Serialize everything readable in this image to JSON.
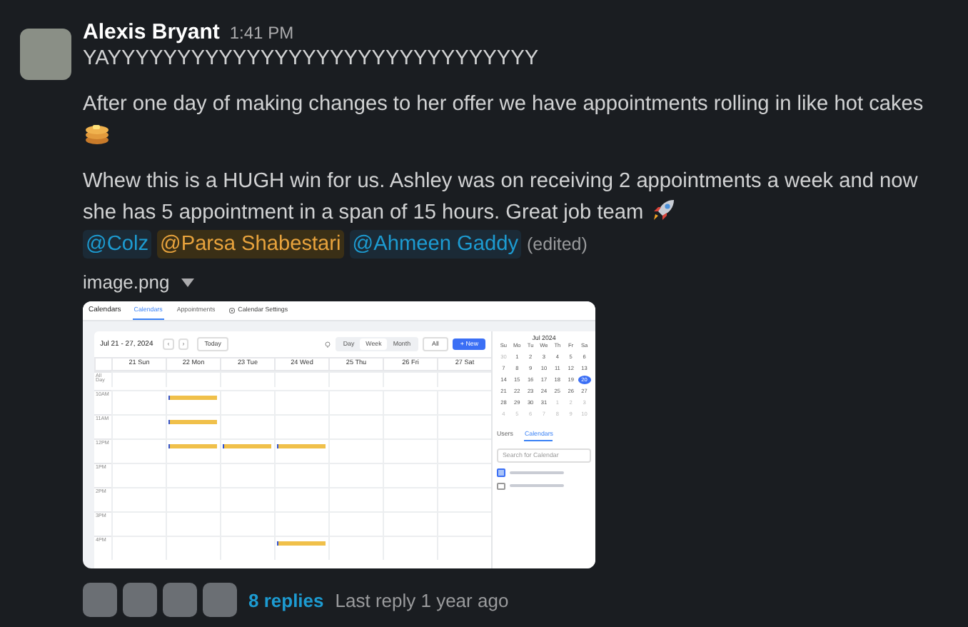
{
  "message": {
    "author": "Alexis Bryant",
    "time": "1:41 PM",
    "paragraphs": [
      {
        "text": "YAYYYYYYYYYYYYYYYYYYYYYYYYYYYYYYY",
        "kind": "plain"
      },
      {
        "text": "After one day of making changes to her offer we have appointments rolling in like hot cakes",
        "kind": "pancakes"
      },
      {
        "text": "Whew this is a HUGH win for us. Ashley was on receiving 2 appointments a week and now she has 5 appointment in a span of 15 hours. Great job team",
        "kind": "rocket"
      }
    ],
    "mentions": [
      {
        "text": "@Colz",
        "kind": "user"
      },
      {
        "text": "@Parsa Shabestari",
        "kind": "highlight"
      },
      {
        "text": "@Ahmeen Gaddy",
        "kind": "user"
      }
    ],
    "edited": "(edited)"
  },
  "attachment": {
    "filename": "image.png",
    "screenshot": {
      "app_title": "Calendars",
      "tabs": [
        {
          "label": "Calendars",
          "selected": true
        },
        {
          "label": "Appointments",
          "selected": false
        }
      ],
      "settings": "Calendar Settings",
      "range": "Jul 21 - 27, 2024",
      "prev": "‹",
      "next": "›",
      "today": "Today",
      "views": [
        {
          "label": "Day",
          "selected": false
        },
        {
          "label": "Week",
          "selected": true
        },
        {
          "label": "Month",
          "selected": false
        }
      ],
      "filter": "All",
      "new_button": "+ New",
      "all_day": "All Day",
      "days": [
        "21 Sun",
        "22 Mon",
        "23 Tue",
        "24 Wed",
        "25 Thu",
        "26 Fri",
        "27 Sat"
      ],
      "rows": [
        {
          "time": "10AM",
          "events": [
            false,
            true,
            false,
            false,
            false,
            false,
            false
          ]
        },
        {
          "time": "11AM",
          "events": [
            false,
            true,
            false,
            false,
            false,
            false,
            false
          ]
        },
        {
          "time": "12PM",
          "events": [
            false,
            true,
            true,
            true,
            false,
            false,
            false
          ]
        },
        {
          "time": "1PM",
          "events": [
            false,
            false,
            false,
            false,
            false,
            false,
            false
          ]
        },
        {
          "time": "2PM",
          "events": [
            false,
            false,
            false,
            false,
            false,
            false,
            false
          ]
        },
        {
          "time": "3PM",
          "events": [
            false,
            false,
            false,
            false,
            false,
            false,
            false
          ]
        },
        {
          "time": "4PM",
          "events": [
            false,
            false,
            false,
            true,
            false,
            false,
            false
          ]
        }
      ],
      "mini_calendar": {
        "month": "Jul 2024",
        "weekdays": [
          "Su",
          "Mo",
          "Tu",
          "We",
          "Th",
          "Fr",
          "Sa"
        ],
        "weeks": [
          [
            {
              "d": "30",
              "muted": true,
              "selected": false
            },
            {
              "d": "1",
              "muted": false,
              "selected": false
            },
            {
              "d": "2",
              "muted": false,
              "selected": false
            },
            {
              "d": "3",
              "muted": false,
              "selected": false
            },
            {
              "d": "4",
              "muted": false,
              "selected": false
            },
            {
              "d": "5",
              "muted": false,
              "selected": false
            },
            {
              "d": "6",
              "muted": false,
              "selected": false
            }
          ],
          [
            {
              "d": "7",
              "muted": false,
              "selected": false
            },
            {
              "d": "8",
              "muted": false,
              "selected": false
            },
            {
              "d": "9",
              "muted": false,
              "selected": false
            },
            {
              "d": "10",
              "muted": false,
              "selected": false
            },
            {
              "d": "11",
              "muted": false,
              "selected": false
            },
            {
              "d": "12",
              "muted": false,
              "selected": false
            },
            {
              "d": "13",
              "muted": false,
              "selected": false
            }
          ],
          [
            {
              "d": "14",
              "muted": false,
              "selected": false
            },
            {
              "d": "15",
              "muted": false,
              "selected": false
            },
            {
              "d": "16",
              "muted": false,
              "selected": false
            },
            {
              "d": "17",
              "muted": false,
              "selected": false
            },
            {
              "d": "18",
              "muted": false,
              "selected": false
            },
            {
              "d": "19",
              "muted": false,
              "selected": false
            },
            {
              "d": "20",
              "muted": false,
              "selected": true
            }
          ],
          [
            {
              "d": "21",
              "muted": false,
              "selected": false
            },
            {
              "d": "22",
              "muted": false,
              "selected": false
            },
            {
              "d": "23",
              "muted": false,
              "selected": false
            },
            {
              "d": "24",
              "muted": false,
              "selected": false
            },
            {
              "d": "25",
              "muted": false,
              "selected": false
            },
            {
              "d": "26",
              "muted": false,
              "selected": false
            },
            {
              "d": "27",
              "muted": false,
              "selected": false
            }
          ],
          [
            {
              "d": "28",
              "muted": false,
              "selected": false
            },
            {
              "d": "29",
              "muted": false,
              "selected": false
            },
            {
              "d": "30",
              "muted": false,
              "selected": false
            },
            {
              "d": "31",
              "muted": false,
              "selected": false
            },
            {
              "d": "1",
              "muted": true,
              "selected": false
            },
            {
              "d": "2",
              "muted": true,
              "selected": false
            },
            {
              "d": "3",
              "muted": true,
              "selected": false
            }
          ],
          [
            {
              "d": "4",
              "muted": true,
              "selected": false
            },
            {
              "d": "5",
              "muted": true,
              "selected": false
            },
            {
              "d": "6",
              "muted": true,
              "selected": false
            },
            {
              "d": "7",
              "muted": true,
              "selected": false
            },
            {
              "d": "8",
              "muted": true,
              "selected": false
            },
            {
              "d": "9",
              "muted": true,
              "selected": false
            },
            {
              "d": "10",
              "muted": true,
              "selected": false
            }
          ]
        ]
      },
      "side_tabs": [
        {
          "label": "Users",
          "selected": false
        },
        {
          "label": "Calendars",
          "selected": true
        }
      ],
      "search_placeholder": "Search for Calendar",
      "calendars": [
        {
          "checked": true
        },
        {
          "checked": false
        }
      ]
    }
  },
  "thread": {
    "participants": [
      {
        "kind": "photo"
      },
      {
        "kind": "photo"
      },
      {
        "kind": "photo"
      },
      {
        "kind": "photo"
      }
    ],
    "replies": "8 replies",
    "last_reply": "Last reply 1 year ago"
  }
}
